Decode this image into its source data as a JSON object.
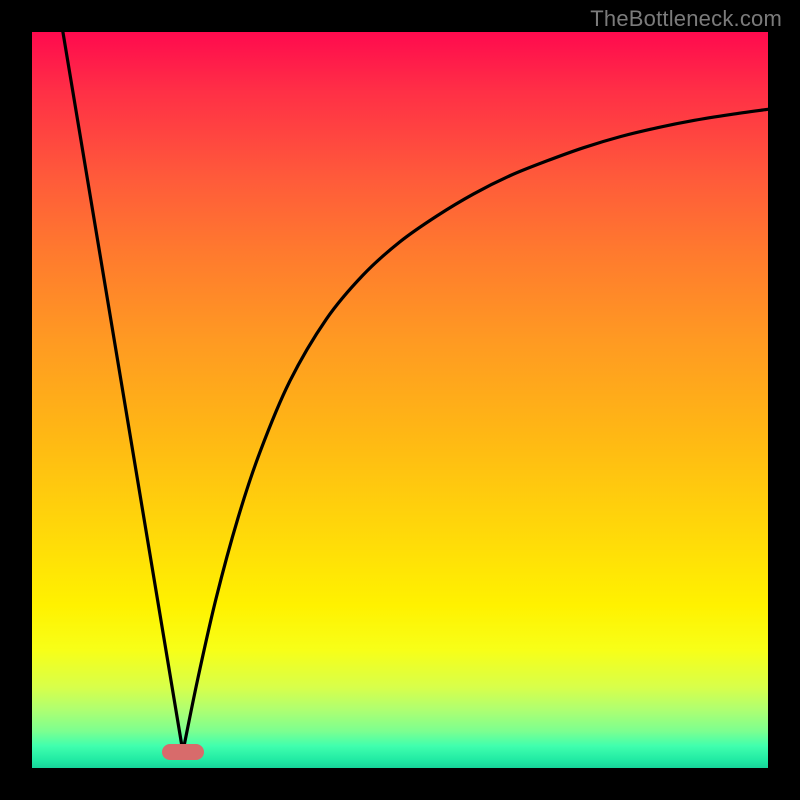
{
  "watermark": {
    "text": "TheBottleneck.com"
  },
  "chart_data": {
    "type": "line",
    "title": "",
    "xlabel": "",
    "ylabel": "",
    "x_range": [
      0,
      1
    ],
    "y_range": [
      0,
      1
    ],
    "marker": {
      "x": 0.205,
      "y": 0.022
    },
    "series": [
      {
        "name": "left-line",
        "x": [
          0.042,
          0.205
        ],
        "y": [
          1.0,
          0.022
        ]
      },
      {
        "name": "right-curve",
        "x": [
          0.205,
          0.225,
          0.25,
          0.28,
          0.31,
          0.35,
          0.4,
          0.45,
          0.5,
          0.55,
          0.6,
          0.65,
          0.7,
          0.75,
          0.8,
          0.85,
          0.9,
          0.95,
          1.0
        ],
        "y": [
          0.022,
          0.12,
          0.23,
          0.34,
          0.43,
          0.525,
          0.61,
          0.67,
          0.715,
          0.75,
          0.78,
          0.805,
          0.825,
          0.843,
          0.858,
          0.87,
          0.88,
          0.888,
          0.895
        ]
      }
    ],
    "background_gradient": {
      "stops": [
        {
          "pos": 0.0,
          "color": "#ff0a4e"
        },
        {
          "pos": 0.5,
          "color": "#ffb814"
        },
        {
          "pos": 0.8,
          "color": "#fff200"
        },
        {
          "pos": 1.0,
          "color": "#17d39a"
        }
      ]
    }
  }
}
